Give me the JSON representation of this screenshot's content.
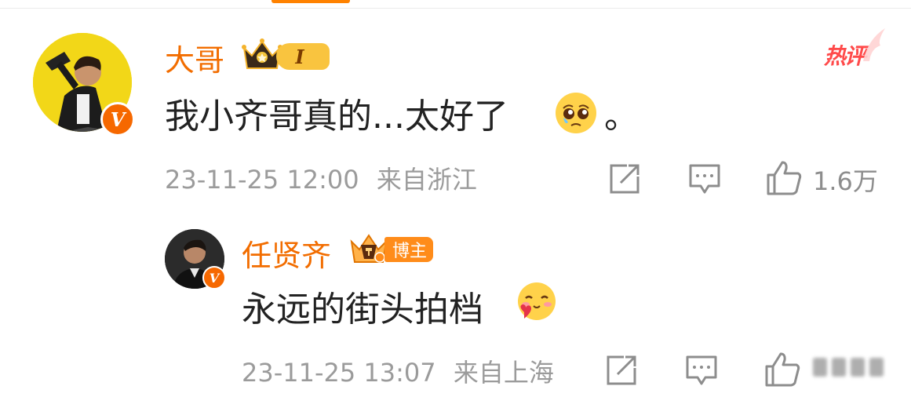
{
  "main_comment": {
    "username": "大哥",
    "rank_badge": "I",
    "hot_label": "热评",
    "text_prefix": "我小齐哥真的...太好了",
    "text_suffix": "。",
    "emoji_icon": "pleading-face-icon",
    "timestamp": "23-11-25 12:00",
    "location": "来自浙江",
    "like_count": "1.6万"
  },
  "reply_comment": {
    "username": "任贤齐",
    "role_badge": "博主",
    "text": "永远的街头拍档",
    "emoji_icon": "blush-heart-face-icon",
    "timestamp": "23-11-25 13:07",
    "location": "来自上海"
  },
  "colors": {
    "accent": "#f26d00",
    "verified": "#f66800",
    "meta_gray": "#9b9b9b",
    "hot_red": "#ff4a4a"
  }
}
